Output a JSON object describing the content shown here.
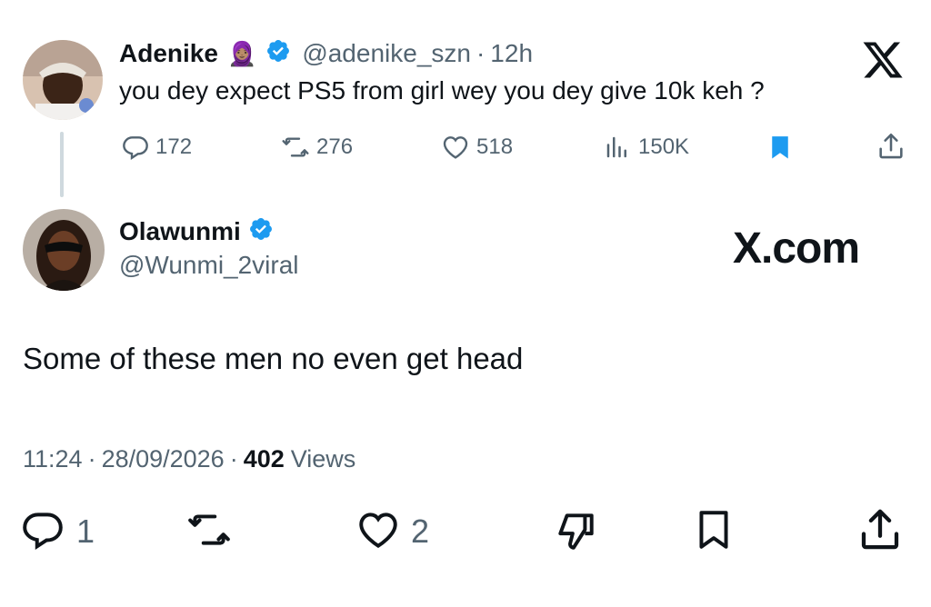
{
  "quoted_tweet": {
    "author_name": "Adenike",
    "author_emoji": "🧕🏽",
    "handle": "@adenike_szn",
    "separator": "·",
    "time": "12h",
    "text": "you dey expect PS5 from girl wey you dey give 10k keh ?",
    "stats": {
      "replies": "172",
      "reposts": "276",
      "likes": "518",
      "views": "150K"
    }
  },
  "main_tweet": {
    "author_name": "Olawunmi",
    "handle": "@Wunmi_2viral",
    "text": "Some of these men no even get head",
    "time": "11:24",
    "date": "28/09/2026",
    "separator": "·",
    "view_count": "402",
    "views_label": "Views",
    "stats": {
      "replies": "1",
      "likes": "2"
    }
  },
  "branding": {
    "logo_letter": "X",
    "watermark": "X.com"
  },
  "colors": {
    "text": "#0f1419",
    "muted": "#536471",
    "verified": "#1d9bf0",
    "bookmark": "#1d9bf0",
    "thread_line": "#cfd9de"
  },
  "icons": [
    "reply-icon",
    "repost-icon",
    "like-icon",
    "views-icon",
    "bookmark-icon",
    "share-icon",
    "dislike-icon",
    "verified-icon",
    "x-logo-icon"
  ]
}
